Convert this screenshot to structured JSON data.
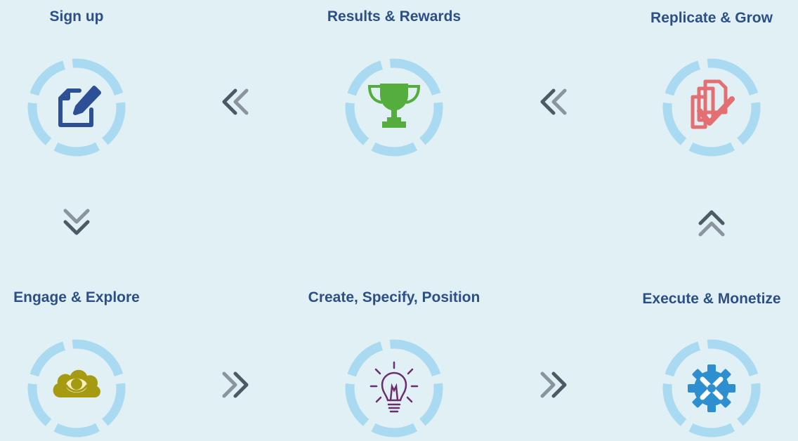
{
  "steps": {
    "sign_up": {
      "title": "Sign up",
      "icon": "document-edit-icon"
    },
    "results_rewards": {
      "title": "Results & Rewards",
      "icon": "trophy-icon"
    },
    "replicate_grow": {
      "title": "Replicate & Grow",
      "icon": "copy-check-icon"
    },
    "engage_explore": {
      "title": "Engage & Explore",
      "icon": "cloud-eye-icon"
    },
    "create_specify_position": {
      "title": "Create, Specify, Position",
      "icon": "lightbulb-icon"
    },
    "execute_monetize": {
      "title": "Execute & Monetize",
      "icon": "gear-tools-icon"
    }
  },
  "colors": {
    "background": "#e0f0f4",
    "title": "#2c4f86",
    "ring": "#aadaf2",
    "arrow_dark": "#4d5a66",
    "arrow_light": "#8b949c",
    "sign_up_icon": "#2c4f96",
    "trophy_icon": "#55ad3d",
    "replicate_icon": "#e46f72",
    "cloud_icon": "#a59a12",
    "bulb_icon": "#6b2d6e",
    "gear_icon": "#2e8fd0"
  }
}
